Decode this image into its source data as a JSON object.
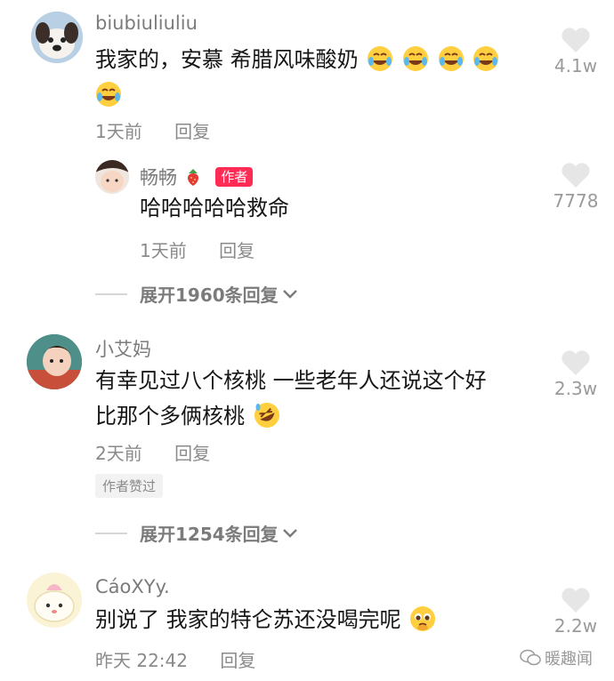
{
  "comments": [
    {
      "username": "biubiuliuliu",
      "text_line1": "我家的，安慕 希腊风味酸奶",
      "time": "1天前",
      "reply_label": "回复",
      "likes": "4.1w",
      "reply": {
        "username": "畅畅",
        "badge": "作者",
        "text": "哈哈哈哈哈救命",
        "time": "1天前",
        "reply_label": "回复",
        "likes": "7778"
      },
      "expand_label": "展开1960条回复"
    },
    {
      "username": "小艾妈",
      "text_line1": "有幸见过八个核桃 一些老年人还说这个好",
      "text_line2": "比那个多俩核桃",
      "time": "2天前",
      "reply_label": "回复",
      "likes": "2.3w",
      "liked_tag": "作者赞过",
      "expand_label": "展开1254条回复"
    },
    {
      "username": "CáoXYy.",
      "text_line1": "别说了 我家的特仑苏还没喝完呢",
      "time": "昨天 22:42",
      "reply_label": "回复",
      "likes": "2.2w"
    }
  ],
  "watermark": "暖趣闻",
  "colors": {
    "author_badge": "#fe2c55",
    "meta": "#8a8a8a",
    "heart": "#e6e6e6"
  }
}
